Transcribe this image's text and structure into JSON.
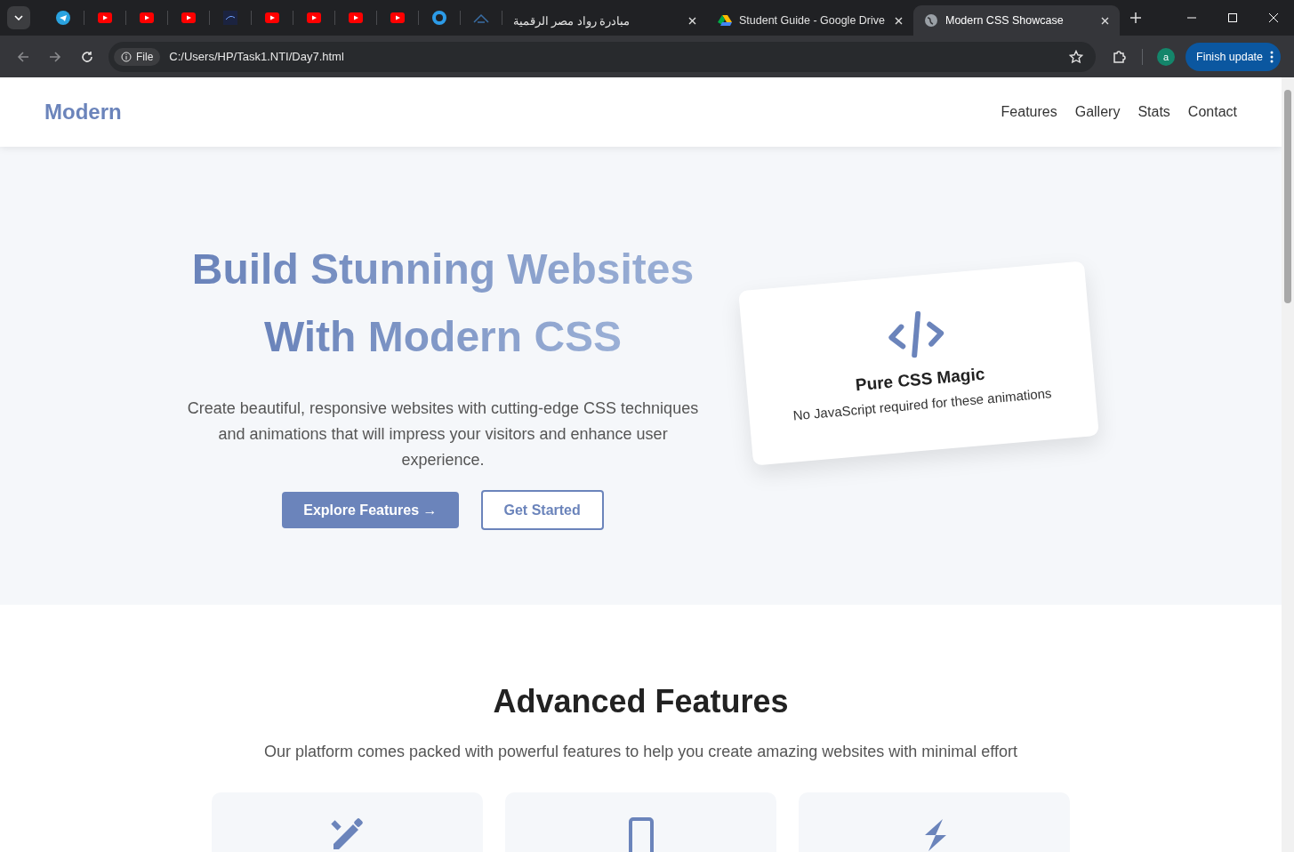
{
  "browser": {
    "tabs": [
      {
        "title": "مبادرة رواد مصر الرقمية",
        "selected": false
      },
      {
        "title": "Student Guide - Google Drive",
        "selected": false
      },
      {
        "title": "Modern CSS Showcase",
        "selected": true
      }
    ],
    "address": {
      "scheme": "File",
      "url": "C:/Users/HP/Task1.NTI/Day7.html"
    },
    "profile": "a",
    "update_button": "Finish update"
  },
  "navbar": {
    "logo": "Modern",
    "links": [
      "Features",
      "Gallery",
      "Stats",
      "Contact"
    ]
  },
  "hero": {
    "title_lines": [
      "Build Stunning Websites",
      "With Modern CSS"
    ],
    "description": "Create beautiful, responsive websites with cutting-edge CSS techniques and animations that will impress your visitors and enhance user experience.",
    "buttons": [
      {
        "label": "Explore Features →",
        "kind": "primary"
      },
      {
        "label": "Get Started",
        "kind": "outline"
      }
    ],
    "card": {
      "title": "Pure CSS Magic",
      "text": "No JavaScript required for these animations"
    }
  },
  "features": {
    "heading": "Advanced Features",
    "subtitle": "Our platform comes packed with powerful features to help you create amazing websites with minimal effort",
    "cards": [
      {
        "kind": "design"
      },
      {
        "kind": "mobile"
      },
      {
        "kind": "speed"
      }
    ]
  }
}
